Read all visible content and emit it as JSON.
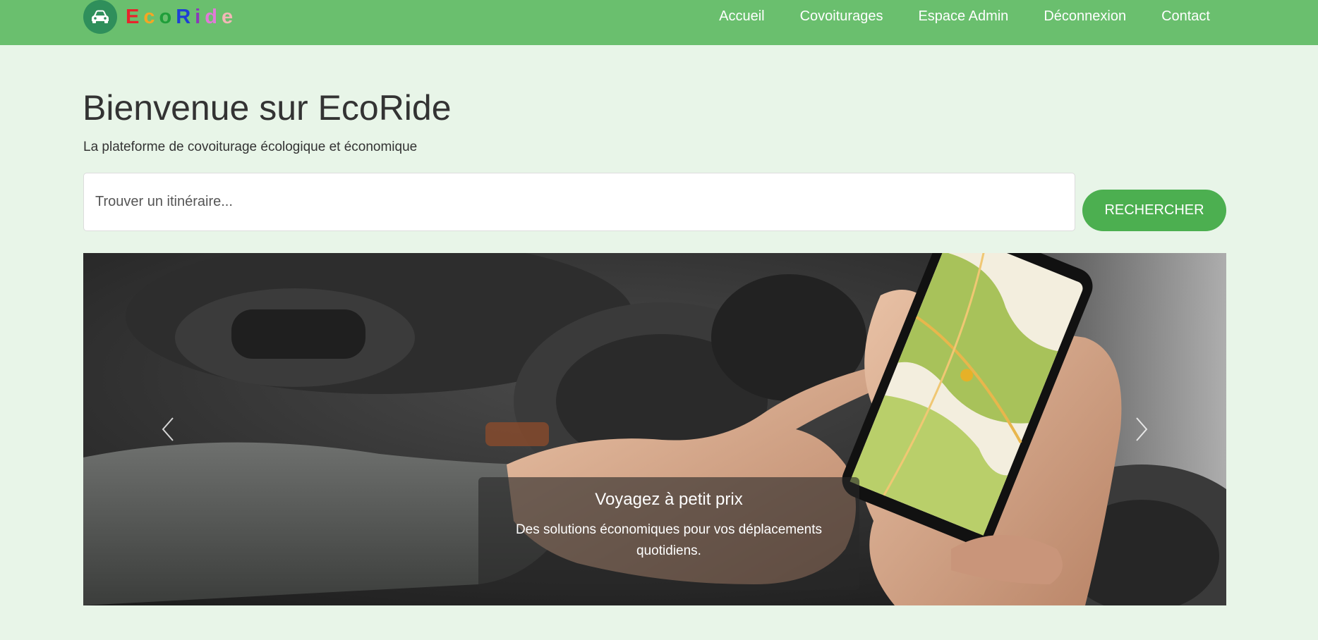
{
  "brand": {
    "logo_icon": "car-icon",
    "letters": [
      {
        "char": "E",
        "color": "#e8242c"
      },
      {
        "char": "c",
        "color": "#f5a623"
      },
      {
        "char": "o",
        "color": "#1f9e3a"
      },
      {
        "char": "R",
        "color": "#1e3fd6"
      },
      {
        "char": "i",
        "color": "#8a3ab9"
      },
      {
        "char": "d",
        "color": "#e07ad8"
      },
      {
        "char": "e",
        "color": "#f3b7b7"
      }
    ]
  },
  "nav": {
    "items": [
      {
        "label": "Accueil"
      },
      {
        "label": "Covoiturages"
      },
      {
        "label": "Espace Admin"
      },
      {
        "label": "Déconnexion"
      },
      {
        "label": "Contact"
      }
    ]
  },
  "hero": {
    "title": "Bienvenue sur EcoRide",
    "subtitle": "La plateforme de covoiturage écologique et économique"
  },
  "search": {
    "placeholder": "Trouver un itinéraire...",
    "button_label": "RECHERCHER"
  },
  "carousel": {
    "slide_title": "Voyagez à petit prix",
    "slide_text": "Des solutions économiques pour vos déplacements quotidiens.",
    "prev_icon": "chevron-left-icon",
    "next_icon": "chevron-right-icon"
  },
  "colors": {
    "navbar": "#6abf6e",
    "page_background": "#e8f5e8",
    "button": "#4caf50",
    "logo_circle": "#2f8f5b"
  }
}
